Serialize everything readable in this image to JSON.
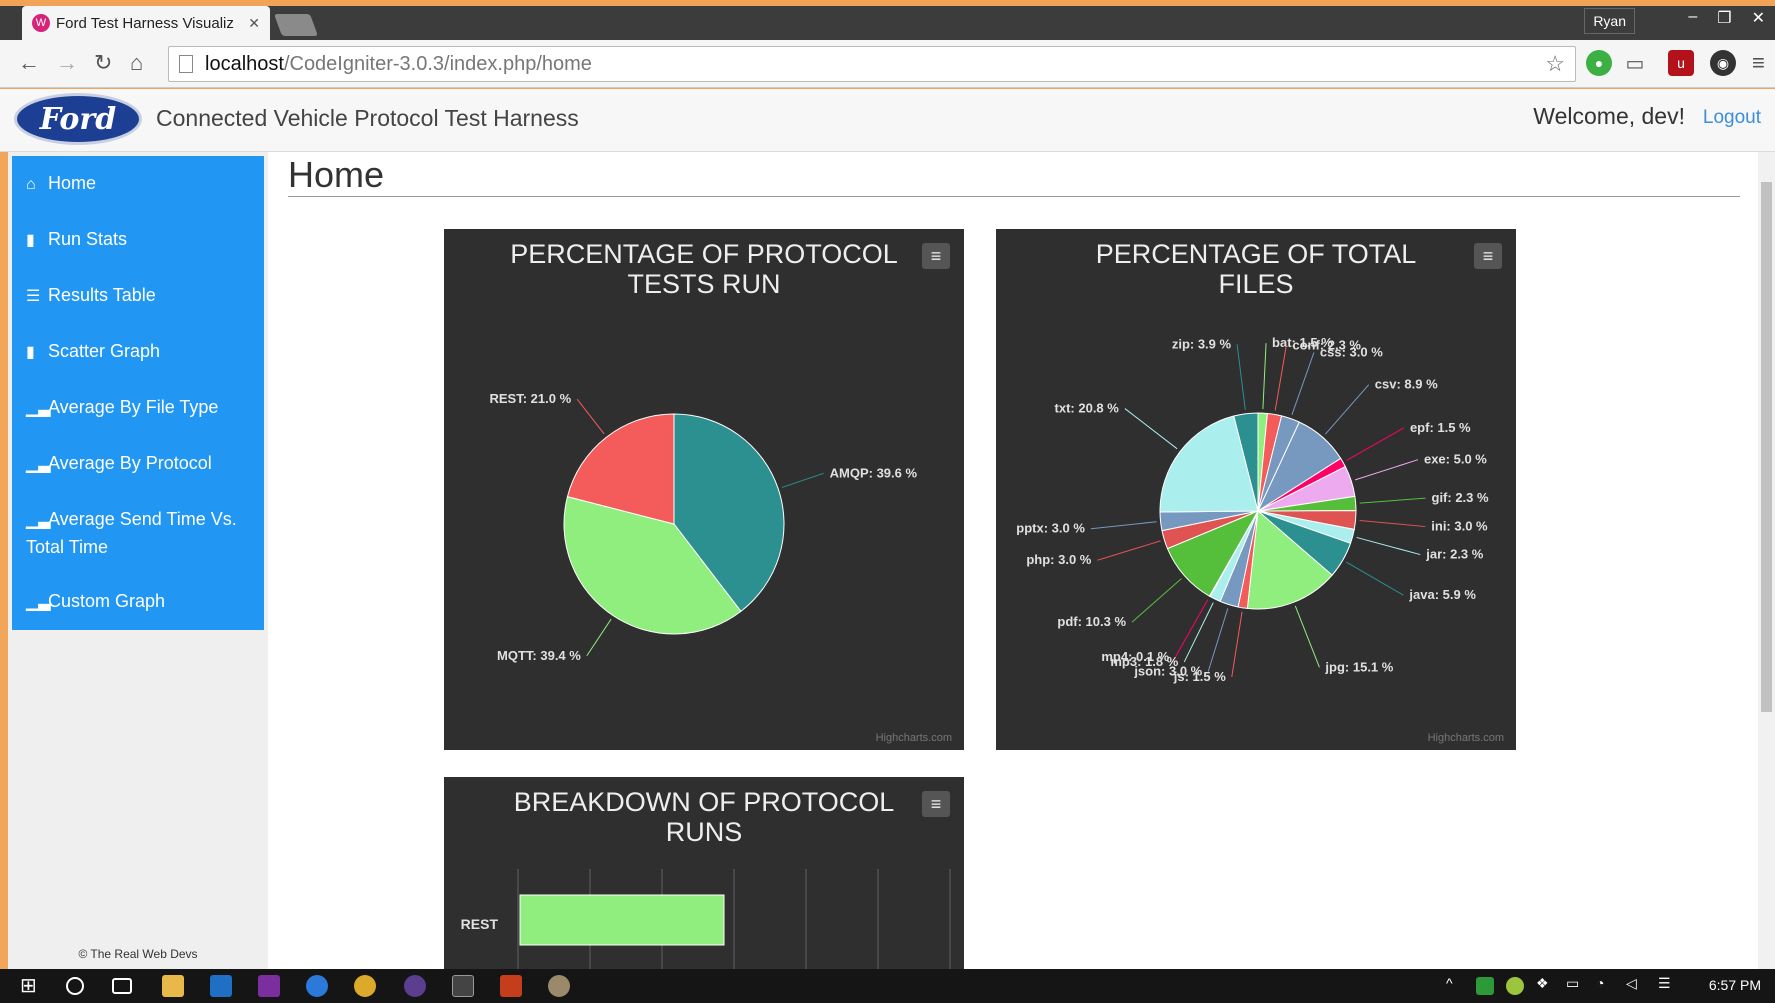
{
  "browser": {
    "tab_title": "Ford Test Harness Visualiz",
    "profile": "Ryan",
    "url_host": "localhost",
    "url_path": "/CodeIgniter-3.0.3/index.php/home"
  },
  "header": {
    "logo_text": "Ford",
    "app_title": "Connected Vehicle Protocol Test Harness",
    "welcome": "Welcome, dev!",
    "logout": "Logout"
  },
  "sidebar": {
    "items": [
      {
        "label": "Home",
        "icon": "home-icon"
      },
      {
        "label": "Run Stats",
        "icon": "bar-chart-icon"
      },
      {
        "label": "Results Table",
        "icon": "table-icon"
      },
      {
        "label": "Scatter Graph",
        "icon": "bar-chart-icon"
      },
      {
        "label": "Average By File Type",
        "icon": "signal-icon"
      },
      {
        "label": "Average By Protocol",
        "icon": "signal-icon"
      },
      {
        "label": "Average Send Time Vs. Total Time",
        "icon": "signal-icon"
      },
      {
        "label": "Custom Graph",
        "icon": "signal-icon"
      }
    ],
    "footer": "© The Real Web Devs"
  },
  "main": {
    "title": "Home",
    "credit": "Highcharts.com"
  },
  "taskbar": {
    "clock": "6:57 PM"
  },
  "chart_data": [
    {
      "type": "pie",
      "title": "PERCENTAGE OF PROTOCOL TESTS RUN",
      "series": [
        {
          "name": "AMQP",
          "value": 39.6,
          "color": "#2b908f"
        },
        {
          "name": "MQTT",
          "value": 39.4,
          "color": "#90ee7e"
        },
        {
          "name": "REST",
          "value": 21.0,
          "color": "#f45b5b"
        }
      ]
    },
    {
      "type": "pie",
      "title": "PERCENTAGE OF TOTAL FILES",
      "series": [
        {
          "name": "bat",
          "value": 1.5,
          "color": "#90ee7e"
        },
        {
          "name": "conf",
          "value": 2.3,
          "color": "#f45b5b"
        },
        {
          "name": "css",
          "value": 3.0,
          "color": "#7798bf"
        },
        {
          "name": "csv",
          "value": 8.9,
          "color": "#7798bf"
        },
        {
          "name": "epf",
          "value": 1.5,
          "color": "#ff0066"
        },
        {
          "name": "exe",
          "value": 5.0,
          "color": "#eeaaee"
        },
        {
          "name": "gif",
          "value": 2.3,
          "color": "#55bf3b"
        },
        {
          "name": "ini",
          "value": 3.0,
          "color": "#df5353"
        },
        {
          "name": "jar",
          "value": 2.3,
          "color": "#aaeeee"
        },
        {
          "name": "java",
          "value": 5.9,
          "color": "#2b908f"
        },
        {
          "name": "jpg",
          "value": 15.1,
          "color": "#90ee7e"
        },
        {
          "name": "js",
          "value": 1.5,
          "color": "#f45b5b"
        },
        {
          "name": "json",
          "value": 3.0,
          "color": "#7798bf"
        },
        {
          "name": "mp3",
          "value": 1.8,
          "color": "#aaeeee"
        },
        {
          "name": "mp4",
          "value": 0.1,
          "color": "#ff0066"
        },
        {
          "name": "pdf",
          "value": 10.3,
          "color": "#55bf3b"
        },
        {
          "name": "php",
          "value": 3.0,
          "color": "#df5353"
        },
        {
          "name": "pptx",
          "value": 3.0,
          "color": "#7798bf"
        },
        {
          "name": "txt",
          "value": 20.8,
          "color": "#aaeeee"
        },
        {
          "name": "zip",
          "value": 3.9,
          "color": "#2b908f"
        }
      ]
    },
    {
      "type": "bar",
      "title": "BREAKDOWN OF PROTOCOL RUNS",
      "categories": [
        "REST"
      ]
    }
  ]
}
